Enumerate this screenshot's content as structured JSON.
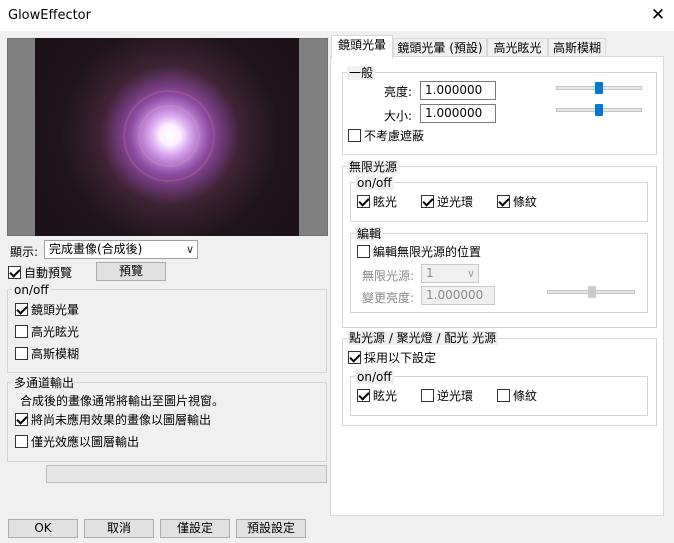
{
  "window": {
    "title": "GlowEffector",
    "close_glyph": "✕"
  },
  "left": {
    "display_label": "顯示:",
    "display_value": "完成畫像(合成後)",
    "auto_preview": {
      "label": "自動預覽",
      "checked": true
    },
    "preview_button": "預覽",
    "onoff_group": {
      "title": "on/off",
      "items": [
        {
          "label": "鏡頭光暈",
          "checked": true
        },
        {
          "label": "高光眩光",
          "checked": false
        },
        {
          "label": "高斯模糊",
          "checked": false
        }
      ]
    },
    "multichannel_group": {
      "title": "多通道輸出",
      "description": "合成後的畫像通常將輸出至圖片視窗。",
      "items": [
        {
          "label": "將尚未應用效果的畫像以圖層輸出",
          "checked": true
        },
        {
          "label": "僅光效應以圖層輸出",
          "checked": false
        }
      ]
    }
  },
  "tabs": [
    "鏡頭光暈",
    "鏡頭光暈 (預設)",
    "高光眩光",
    "高斯模糊"
  ],
  "panel": {
    "general": {
      "title": "一般",
      "brightness_label": "亮度:",
      "brightness_value": "1.000000",
      "size_label": "大小:",
      "size_value": "1.000000",
      "ignore_occlusion": {
        "label": "不考慮遮蔽",
        "checked": false
      }
    },
    "infinite": {
      "title": "無限光源",
      "onoff_title": "on/off",
      "items": [
        {
          "label": "眩光",
          "checked": true
        },
        {
          "label": "逆光環",
          "checked": true
        },
        {
          "label": "條紋",
          "checked": true
        }
      ],
      "edit_title": "編輯",
      "edit_position": {
        "label": "編輯無限光源的位置",
        "checked": false
      },
      "source_label": "無限光源:",
      "source_value": "1",
      "change_brightness_label": "變更亮度:",
      "change_brightness_value": "1.000000"
    },
    "point": {
      "title": "點光源 / 聚光燈 / 配光 光源",
      "use_following": {
        "label": "採用以下設定",
        "checked": true
      },
      "onoff_title": "on/off",
      "items": [
        {
          "label": "眩光",
          "checked": true
        },
        {
          "label": "逆光環",
          "checked": false
        },
        {
          "label": "條紋",
          "checked": false
        }
      ]
    }
  },
  "footer": {
    "ok": "OK",
    "cancel": "取消",
    "only_set": "僅設定",
    "default_set": "預設設定"
  },
  "colors": {
    "accent": "#0078d7",
    "background": "#f0f0f0"
  }
}
